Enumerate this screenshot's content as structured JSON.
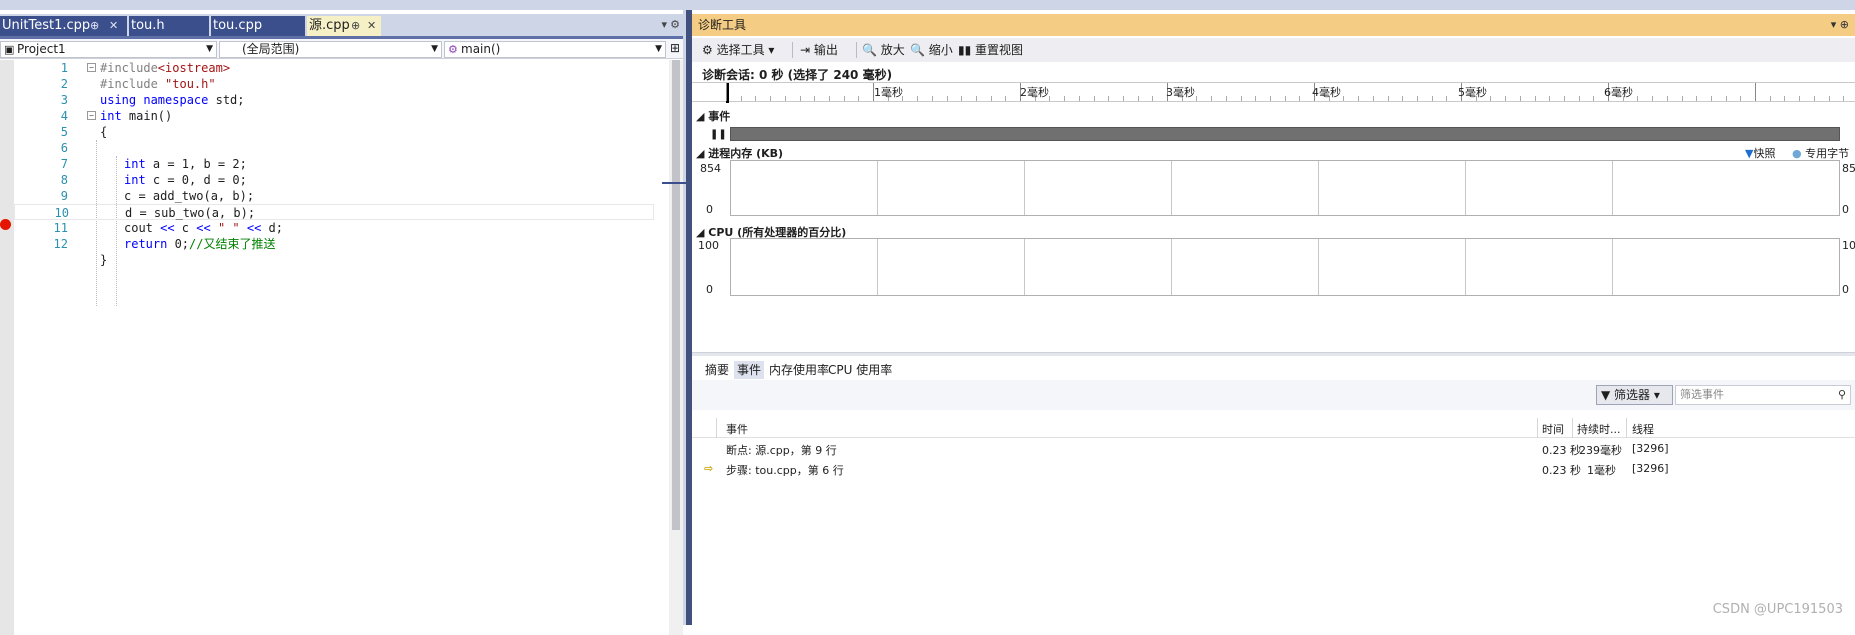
{
  "editor": {
    "tabs": [
      {
        "label": "UnitTest1.cpp",
        "pin": "⊕",
        "close": "✕"
      },
      {
        "label": "tou.h",
        "pin": "",
        "close": ""
      },
      {
        "label": "tou.cpp",
        "pin": "",
        "close": ""
      },
      {
        "label": "源.cpp",
        "pin": "⊕",
        "close": "✕"
      }
    ],
    "tab_dropdown_icon": "▾ ⚙",
    "nav": {
      "project": "Project1",
      "scope": "(全局范围)",
      "member": "main()",
      "split_icon": "⊞"
    },
    "lines": [
      {
        "n": "1"
      },
      {
        "n": "2"
      },
      {
        "n": "3"
      },
      {
        "n": "4"
      },
      {
        "n": "5"
      },
      {
        "n": "6"
      },
      {
        "n": "7"
      },
      {
        "n": "8"
      },
      {
        "n": "9"
      },
      {
        "n": "10"
      },
      {
        "n": "11"
      },
      {
        "n": "12"
      }
    ],
    "code": {
      "l1_pp": "#include",
      "l1_str": "<iostream>",
      "l2_pp": "#include",
      "l2_str": "\"tou.h\"",
      "l3_kw": "using namespace",
      "l3_rest": " std;",
      "l4_kw": "int",
      "l4_rest": " main()",
      "l5": "{",
      "l7_kw": "int",
      "l7_rest": " a = 1, b = 2;",
      "l8_kw": "int",
      "l8_rest": " c = 0, d = 0;",
      "l9": "c = add_two(a, b);",
      "l10": "d = sub_two(a, b);",
      "l11_a": "cout ",
      "l11_op1": "<<",
      "l11_b": " c ",
      "l11_op2": "<<",
      "l11_str": " \" \" ",
      "l11_op3": "<<",
      "l11_c": " d;",
      "l12_kw": "return",
      "l12_rest": " 0;",
      "l12_com": "//又结束了推送",
      "l13": "}"
    }
  },
  "diag": {
    "title": "诊断工具",
    "title_ctrls": "▾ ⊕",
    "toolbar": {
      "select_tool": "⚙ 选择工具 ▾",
      "output": "⇥ 输出",
      "zoom_in": "🔍 放大",
      "zoom_out": "🔍 缩小",
      "reset_view": "重置视图"
    },
    "session": "诊断会话: 0 秒 (选择了 240 毫秒)",
    "ruler_labels": [
      "1毫秒",
      "2毫秒",
      "3毫秒",
      "4毫秒",
      "5毫秒",
      "6毫秒"
    ],
    "events_header": "◢ 事件",
    "pause": "❚❚",
    "memory_header": "◢ 进程内存 (KB)",
    "memory_max": "854",
    "memory_max_right": "85",
    "memory_min": "0",
    "legend_snapshot": "▼快照",
    "legend_private": "● 专用字节",
    "cpu_header": "◢ CPU (所有处理器的百分比)",
    "cpu_max": "100",
    "cpu_max_right": "10",
    "cpu_min": "0",
    "subtabs": [
      "摘要",
      "事件",
      "内存使用率",
      "CPU 使用率"
    ],
    "filter_button": "▼ 筛选器 ▾",
    "filter_placeholder": "筛选事件",
    "filter_search_icon": "⚲",
    "table": {
      "headers": {
        "event": "事件",
        "time": "时间",
        "duration": "持续时...",
        "thread": "线程"
      },
      "rows": [
        {
          "icon": "",
          "event": "断点: 源.cpp，第 9 行",
          "time": "0.23 秒",
          "duration": "239毫秒",
          "thread": "[3296]"
        },
        {
          "icon": "⇨",
          "event": "步骤: tou.cpp，第 6 行",
          "time": "0.23 秒",
          "duration": "1毫秒",
          "thread": "[3296]"
        }
      ]
    }
  },
  "watermark": "CSDN @UPC191503",
  "colors": {
    "accent": "#3c4f8d",
    "active_tab": "#f5f0c6",
    "diag_title": "#f5cc84",
    "breakpoint": "#e51400",
    "keyword": "#0000ff",
    "comment": "#008000",
    "string": "#a31515",
    "line_number": "#2b91af"
  }
}
